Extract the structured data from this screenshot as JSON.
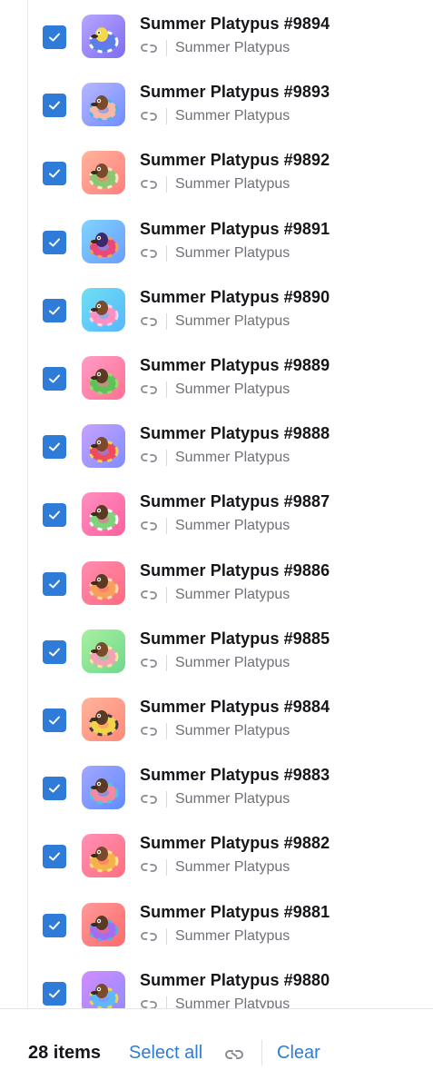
{
  "items": [
    {
      "name": "Summer Platypus #9894",
      "collection": "Summer Platypus",
      "checked": true,
      "bg": [
        "#b8a6ff",
        "#7d6df0"
      ],
      "ring": "#5b7fe8",
      "ring2": "#ffffff",
      "accent": "#f2d84a"
    },
    {
      "name": "Summer Platypus #9893",
      "collection": "Summer Platypus",
      "checked": true,
      "bg": [
        "#b9b7ff",
        "#6f8cff"
      ],
      "ring": "#f7b9a5",
      "ring2": "#4fb1e6",
      "accent": "#7a4a2a"
    },
    {
      "name": "Summer Platypus #9892",
      "collection": "Summer Platypus",
      "checked": true,
      "bg": [
        "#ffb59b",
        "#ff7e7e"
      ],
      "ring": "#8cc76f",
      "ring2": "#f6e7c9",
      "accent": "#7a4a2a"
    },
    {
      "name": "Summer Platypus #9891",
      "collection": "Summer Platypus",
      "checked": true,
      "bg": [
        "#7fd5ff",
        "#6c9bff"
      ],
      "ring": "#e8497a",
      "ring2": "#f3a34b",
      "accent": "#3b2a6b"
    },
    {
      "name": "Summer Platypus #9890",
      "collection": "Summer Platypus",
      "checked": true,
      "bg": [
        "#6fe0f0",
        "#56b7ff"
      ],
      "ring": "#ff8fc2",
      "ring2": "#ffd2e8",
      "accent": "#7a4a2a"
    },
    {
      "name": "Summer Platypus #9889",
      "collection": "Summer Platypus",
      "checked": true,
      "bg": [
        "#ff9cc7",
        "#ff6f91"
      ],
      "ring": "#5fc15a",
      "ring2": "#9ad86b",
      "accent": "#5a3a22"
    },
    {
      "name": "Summer Platypus #9888",
      "collection": "Summer Platypus",
      "checked": true,
      "bg": [
        "#c8a2ff",
        "#7f8dff"
      ],
      "ring": "#f04a5e",
      "ring2": "#f7d24a",
      "accent": "#7a4a2a"
    },
    {
      "name": "Summer Platypus #9887",
      "collection": "Summer Platypus",
      "checked": true,
      "bg": [
        "#ff8fbf",
        "#ff5f9e"
      ],
      "ring": "#7fd37a",
      "ring2": "#ffffff",
      "accent": "#5a3a22"
    },
    {
      "name": "Summer Platypus #9886",
      "collection": "Summer Platypus",
      "checked": true,
      "bg": [
        "#ff8db0",
        "#ff6a7d"
      ],
      "ring": "#f6a05c",
      "ring2": "#ffd9b0",
      "accent": "#5a3a22"
    },
    {
      "name": "Summer Platypus #9885",
      "collection": "Summer Platypus",
      "checked": true,
      "bg": [
        "#a8f0a0",
        "#6fd88f"
      ],
      "ring": "#f4a2b8",
      "ring2": "#ffe29a",
      "accent": "#7a4a2a"
    },
    {
      "name": "Summer Platypus #9884",
      "collection": "Summer Platypus",
      "checked": true,
      "bg": [
        "#ffb39b",
        "#ff8a7a"
      ],
      "ring": "#f3d34a",
      "ring2": "#3b3b4a",
      "accent": "#5a3a22"
    },
    {
      "name": "Summer Platypus #9883",
      "collection": "Summer Platypus",
      "checked": true,
      "bg": [
        "#a4a6ff",
        "#5f8cff"
      ],
      "ring": "#f28aa0",
      "ring2": "#4fc6e0",
      "accent": "#5a3a22"
    },
    {
      "name": "Summer Platypus #9882",
      "collection": "Summer Platypus",
      "checked": true,
      "bg": [
        "#ff8fb6",
        "#ff6f7e"
      ],
      "ring": "#f5b24a",
      "ring2": "#ffe38a",
      "accent": "#7a4a2a"
    },
    {
      "name": "Summer Platypus #9881",
      "collection": "Summer Platypus",
      "checked": true,
      "bg": [
        "#ff9a9a",
        "#ff6a6a"
      ],
      "ring": "#a46cf0",
      "ring2": "#4fb1e6",
      "accent": "#5a3a22"
    },
    {
      "name": "Summer Platypus #9880",
      "collection": "Summer Platypus",
      "checked": true,
      "bg": [
        "#d48cff",
        "#8f8cff"
      ],
      "ring": "#5fb7ff",
      "ring2": "#f3d34a",
      "accent": "#7a4a2a"
    }
  ],
  "footer": {
    "count_label": "28 items",
    "select_all_label": "Select all",
    "clear_label": "Clear"
  },
  "colors": {
    "accent": "#2f7bd8",
    "text_primary": "#16161a",
    "text_secondary": "#707078",
    "icon_gray": "#8a8a92"
  },
  "icons": {
    "checkbox": "checkmark-icon",
    "link": "link-icon"
  }
}
